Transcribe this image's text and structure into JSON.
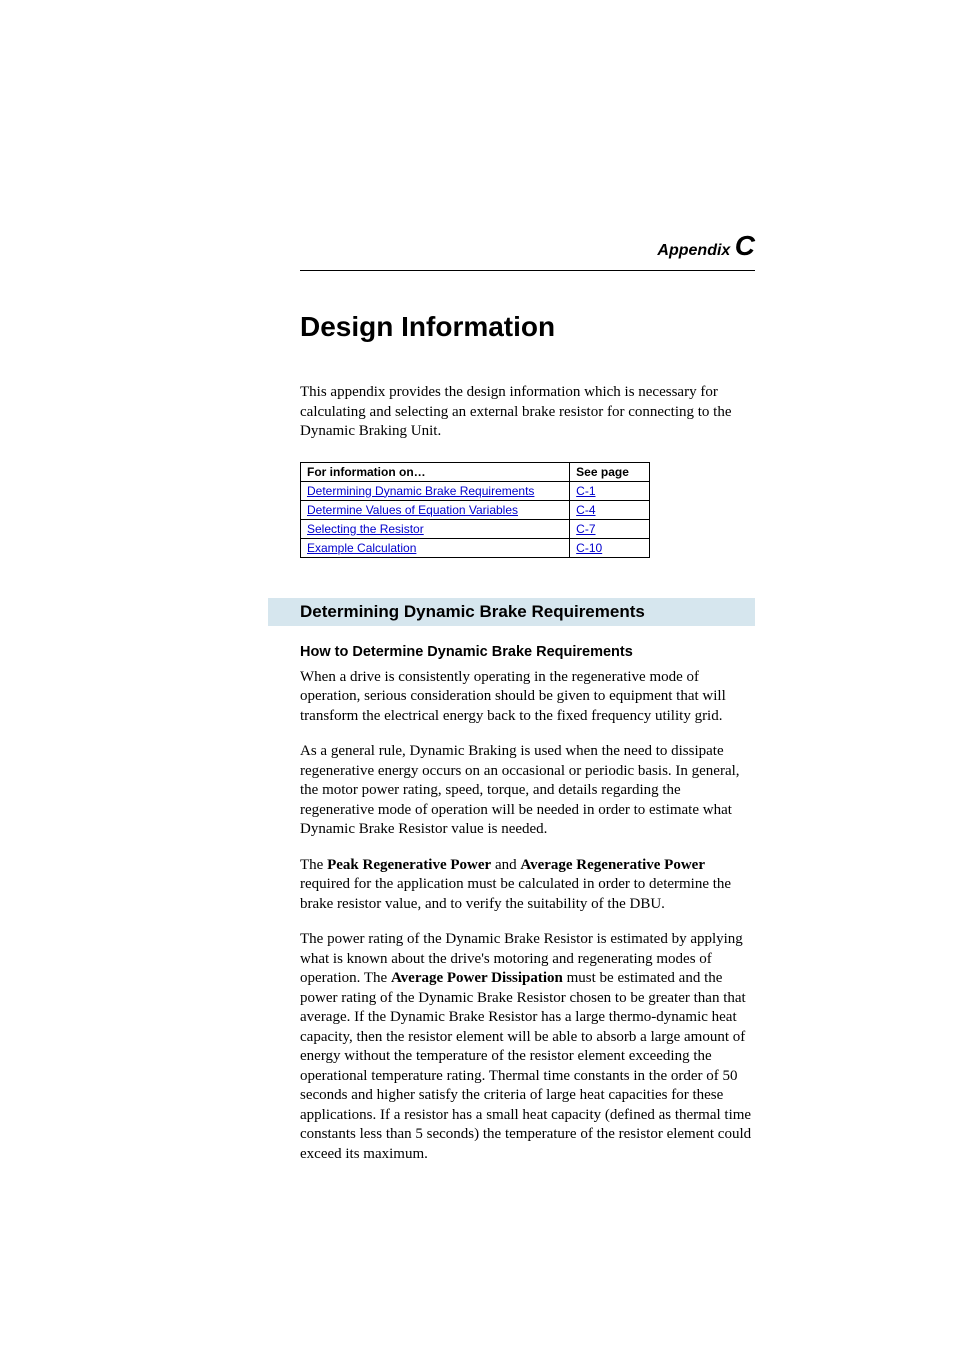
{
  "appendix": {
    "label_prefix": "Appendix ",
    "letter": "C"
  },
  "title": "Design Information",
  "intro": "This appendix provides the design information which is necessary for calculating and selecting an external brake resistor for connecting to the Dynamic Braking Unit.",
  "toc": {
    "header_info": "For information on…",
    "header_page": "See page",
    "rows": [
      {
        "label": "Determining Dynamic Brake Requirements",
        "page": "C-1"
      },
      {
        "label": "Determine Values of Equation Variables",
        "page": "C-4"
      },
      {
        "label": "Selecting the Resistor",
        "page": "C-7"
      },
      {
        "label": "Example Calculation",
        "page": "C-10"
      }
    ]
  },
  "section": {
    "heading": "Determining Dynamic Brake Requirements",
    "subheading": "How to Determine Dynamic Brake Requirements",
    "p1": "When a drive is consistently operating in the regenerative mode of operation, serious consideration should be given to equipment that will transform the electrical energy back to the fixed frequency utility grid.",
    "p2": "As a general rule, Dynamic Braking is used when the need to dissipate regenerative energy occurs on an occasional or periodic basis. In general, the motor power rating, speed, torque, and details regarding the regenerative mode of operation will be needed in order to estimate what Dynamic Brake Resistor value is needed.",
    "p3_pre": "The ",
    "p3_b1": "Peak Regenerative Power",
    "p3_mid": " and ",
    "p3_b2": "Average Regenerative Power",
    "p3_post": " required for the application must be calculated in order to determine the brake resistor value, and to verify the suitability of the DBU.",
    "p4_pre": "The power rating of the Dynamic Brake Resistor is estimated by applying what is known about the drive's motoring and regenerating modes of operation. The ",
    "p4_b1": "Average Power Dissipation",
    "p4_post": " must be estimated and the power rating of the Dynamic Brake Resistor chosen to be greater than that average. If the Dynamic Brake Resistor has a large thermo-dynamic heat capacity, then the resistor element will be able to absorb a large amount of energy without the temperature of the resistor element exceeding the operational temperature rating. Thermal time constants in the order of 50 seconds and higher satisfy the criteria of large heat capacities for these applications. If a resistor has a small heat capacity (defined as thermal time constants less than 5 seconds) the temperature of the resistor element could exceed its maximum."
  }
}
